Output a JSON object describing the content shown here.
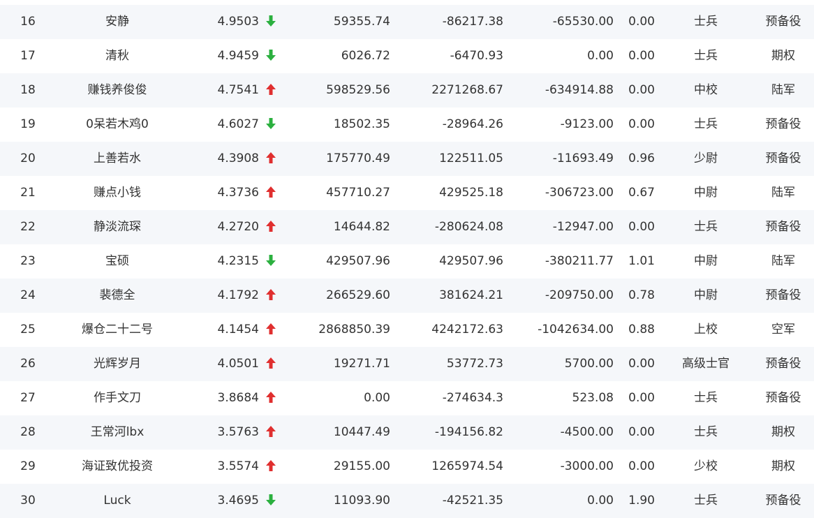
{
  "colors": {
    "stripe": "#f5f7fa",
    "text": "#333333",
    "up": "#e02f2f",
    "down": "#2bb03f"
  },
  "rows": [
    {
      "rank": "16",
      "name": "安静",
      "score": "4.9503",
      "trend": "down",
      "v1": "59355.74",
      "v2": "-86217.38",
      "v3": "-65530.00",
      "v4": "0.00",
      "title": "士兵",
      "category": "预备役"
    },
    {
      "rank": "17",
      "name": "清秋",
      "score": "4.9459",
      "trend": "down",
      "v1": "6026.72",
      "v2": "-6470.93",
      "v3": "0.00",
      "v4": "0.00",
      "title": "士兵",
      "category": "期权"
    },
    {
      "rank": "18",
      "name": "赚钱养俊俊",
      "score": "4.7541",
      "trend": "up",
      "v1": "598529.56",
      "v2": "2271268.67",
      "v3": "-634914.88",
      "v4": "0.00",
      "title": "中校",
      "category": "陆军"
    },
    {
      "rank": "19",
      "name": "0呆若木鸡0",
      "score": "4.6027",
      "trend": "down",
      "v1": "18502.35",
      "v2": "-28964.26",
      "v3": "-9123.00",
      "v4": "0.00",
      "title": "士兵",
      "category": "预备役"
    },
    {
      "rank": "20",
      "name": "上善若水",
      "score": "4.3908",
      "trend": "up",
      "v1": "175770.49",
      "v2": "122511.05",
      "v3": "-11693.49",
      "v4": "0.96",
      "title": "少尉",
      "category": "预备役"
    },
    {
      "rank": "21",
      "name": "赚点小钱",
      "score": "4.3736",
      "trend": "up",
      "v1": "457710.27",
      "v2": "429525.18",
      "v3": "-306723.00",
      "v4": "0.67",
      "title": "中尉",
      "category": "陆军"
    },
    {
      "rank": "22",
      "name": "静淡流琛",
      "score": "4.2720",
      "trend": "up",
      "v1": "14644.82",
      "v2": "-280624.08",
      "v3": "-12947.00",
      "v4": "0.00",
      "title": "士兵",
      "category": "预备役"
    },
    {
      "rank": "23",
      "name": "宝硕",
      "score": "4.2315",
      "trend": "down",
      "v1": "429507.96",
      "v2": "429507.96",
      "v3": "-380211.77",
      "v4": "1.01",
      "title": "中尉",
      "category": "陆军"
    },
    {
      "rank": "24",
      "name": "裴德全",
      "score": "4.1792",
      "trend": "up",
      "v1": "266529.60",
      "v2": "381624.21",
      "v3": "-209750.00",
      "v4": "0.78",
      "title": "中尉",
      "category": "预备役"
    },
    {
      "rank": "25",
      "name": "爆仓二十二号",
      "score": "4.1454",
      "trend": "up",
      "v1": "2868850.39",
      "v2": "4242172.63",
      "v3": "-1042634.00",
      "v4": "0.88",
      "title": "上校",
      "category": "空军"
    },
    {
      "rank": "26",
      "name": "光辉岁月",
      "score": "4.0501",
      "trend": "up",
      "v1": "19271.71",
      "v2": "53772.73",
      "v3": "5700.00",
      "v4": "0.00",
      "title": "高级士官",
      "category": "预备役"
    },
    {
      "rank": "27",
      "name": "作手文刀",
      "score": "3.8684",
      "trend": "up",
      "v1": "0.00",
      "v2": "-274634.3",
      "v3": "523.08",
      "v4": "0.00",
      "title": "士兵",
      "category": "预备役"
    },
    {
      "rank": "28",
      "name": "王常河lbx",
      "score": "3.5763",
      "trend": "up",
      "v1": "10447.49",
      "v2": "-194156.82",
      "v3": "-4500.00",
      "v4": "0.00",
      "title": "士兵",
      "category": "期权"
    },
    {
      "rank": "29",
      "name": "海证致优投资",
      "score": "3.5574",
      "trend": "up",
      "v1": "29155.00",
      "v2": "1265974.54",
      "v3": "-3000.00",
      "v4": "0.00",
      "title": "少校",
      "category": "期权"
    },
    {
      "rank": "30",
      "name": "Luck",
      "score": "3.4695",
      "trend": "down",
      "v1": "11093.90",
      "v2": "-42521.35",
      "v3": "0.00",
      "v4": "1.90",
      "title": "士兵",
      "category": "预备役"
    }
  ]
}
